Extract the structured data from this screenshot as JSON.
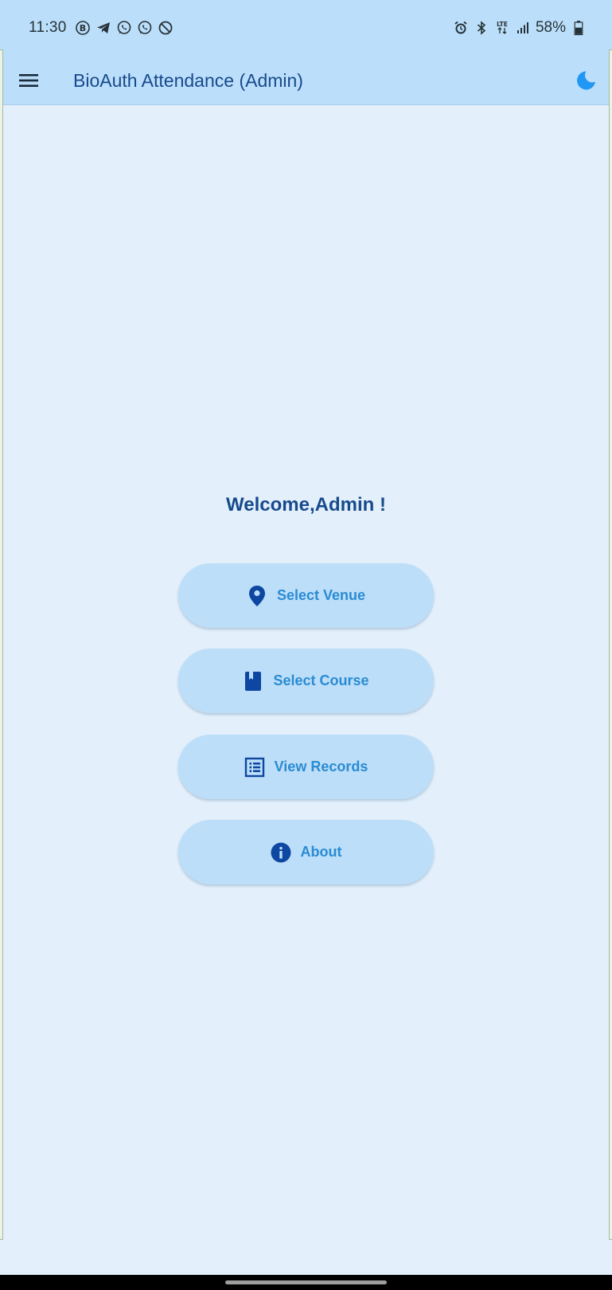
{
  "status_bar": {
    "time": "11:30",
    "left_icons": [
      "b-circle-icon",
      "telegram-icon",
      "whatsapp-icon",
      "whatsapp-icon",
      "do-not-disturb-icon"
    ],
    "right_icons": [
      "alarm-icon",
      "bluetooth-icon",
      "lte-icon",
      "signal-icon"
    ],
    "battery_text": "58%",
    "battery_level": 0.58
  },
  "app_bar": {
    "title": "BioAuth Attendance (Admin)",
    "menu_icon": "hamburger-menu-icon",
    "theme_icon": "moon-icon"
  },
  "main": {
    "welcome": "Welcome,Admin !",
    "buttons": [
      {
        "label": "Select Venue",
        "icon": "location-pin-icon"
      },
      {
        "label": "Select Course",
        "icon": "book-icon"
      },
      {
        "label": "View Records",
        "icon": "list-icon"
      },
      {
        "label": "About",
        "icon": "info-icon"
      }
    ]
  },
  "colors": {
    "background": "#e3f0fc",
    "app_bar": "#bbdefa",
    "title_text": "#174a8c",
    "button_bg": "#bcdef8",
    "button_text": "#2a8bd3",
    "icon_dark": "#0d47a1",
    "moon_icon": "#2196f3"
  }
}
